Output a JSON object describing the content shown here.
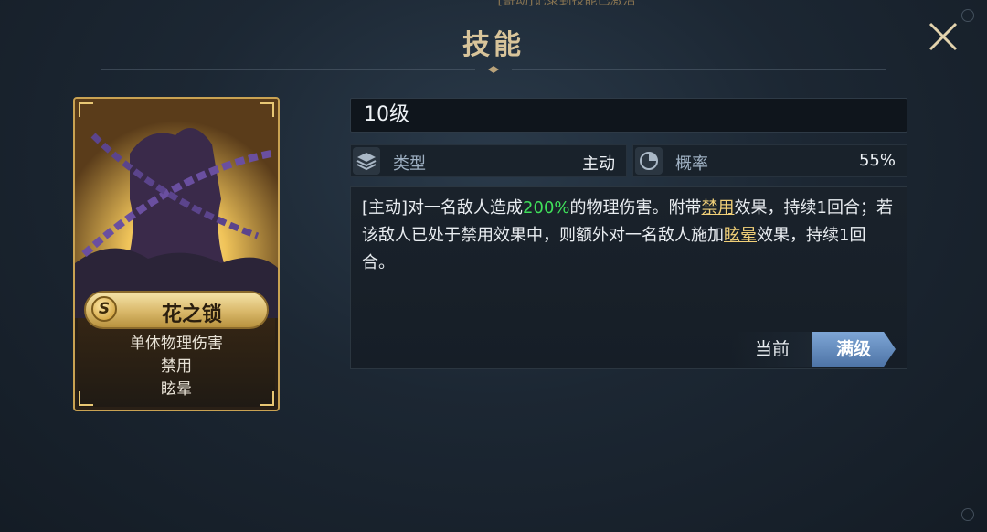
{
  "top_banner": "[寄动]记录到技能已激活",
  "title": "技能",
  "card": {
    "badge": "S",
    "name": "花之锁",
    "tags": [
      "单体物理伤害",
      "禁用",
      "眩晕"
    ]
  },
  "level": "10级",
  "stats": [
    {
      "icon": "layers-icon",
      "label": "类型",
      "value": "主动"
    },
    {
      "icon": "pie-chart-icon",
      "label": "概率",
      "value": "55%"
    }
  ],
  "description": {
    "seg1": "[主动]对一名敌人造成",
    "seg2": "200%",
    "seg3": "的物理伤害。附带",
    "seg4": "禁用",
    "seg5": "效果，持续1回合；若该敌人已处于禁用效果中，则额外对一名敌人施加",
    "seg6": "眩晕",
    "seg7": "效果，持续1回合。"
  },
  "tabs": {
    "current": "当前",
    "max": "满级"
  },
  "colors": {
    "accent_gold": "#c9a252",
    "highlight_green": "#3fe05a",
    "link_gold": "#f0cf78",
    "tab_active": "#6a8fc0"
  }
}
